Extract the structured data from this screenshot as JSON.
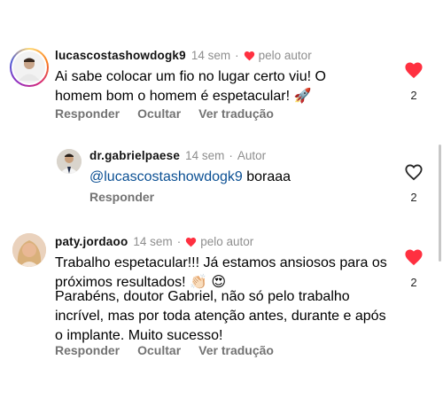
{
  "comments": [
    {
      "username": "lucascostashowdogk9",
      "time": "14 sem",
      "separator": "·",
      "author_badge": "pelo autor",
      "text": "Ai sabe colocar um fio no lugar certo viu! O homem bom o homem é espetacular! 🚀",
      "like_count": "2",
      "liked": true,
      "actions": {
        "reply": "Responder",
        "hide": "Ocultar",
        "translate": "Ver tradução"
      }
    },
    {
      "username": "dr.gabrielpaese",
      "time": "14 sem",
      "separator": "·",
      "author_label": "Autor",
      "mention": "@lucascostashowdogk9",
      "text": " boraaa",
      "like_count": "2",
      "liked": false,
      "actions": {
        "reply": "Responder"
      }
    },
    {
      "username": "paty.jordaoo",
      "time": "14 sem",
      "separator": "·",
      "author_badge": "pelo autor",
      "text_p1": "Trabalho espetacular!!! Já estamos ansiosos para os próximos resultados! 👏🏻 😍",
      "text_p2": "Parabéns, doutor Gabriel, não só pelo trabalho incrível, mas por toda atenção antes, durante e após o implante. Muito sucesso!",
      "like_count": "2",
      "liked": true,
      "actions": {
        "reply": "Responder",
        "hide": "Ocultar",
        "translate": "Ver tradução"
      }
    }
  ],
  "colors": {
    "like_red": "#ff3040",
    "mention_blue": "#0a4f93",
    "muted": "#8e8e8e"
  }
}
